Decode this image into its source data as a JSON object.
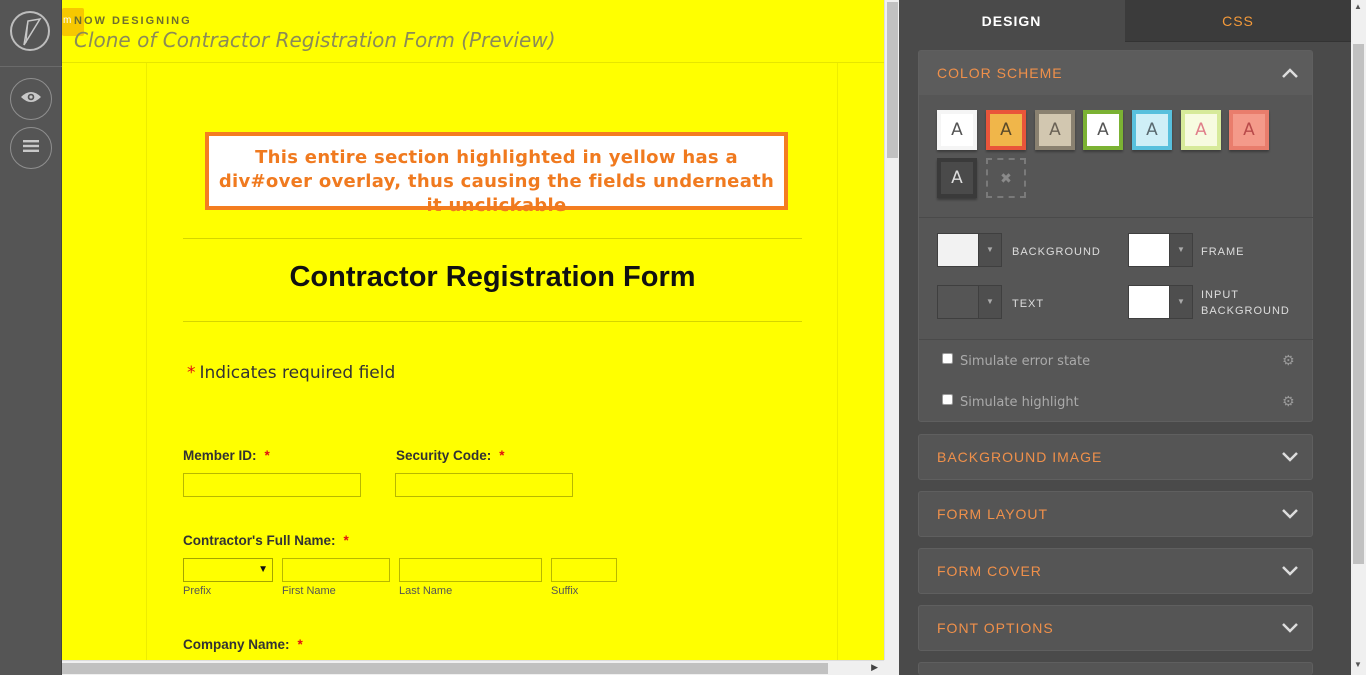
{
  "header": {
    "badge": "m",
    "label": "NOW DESIGNING",
    "title": "Clone of Contractor Registration Form (Preview)"
  },
  "rail": {
    "logo_icon": "pencil-logo-icon",
    "buttons": [
      "eye-icon",
      "menu-icon"
    ]
  },
  "form": {
    "note": "This entire section highlighted in yellow has a div#over overlay, thus causing the fields underneath it unclickable",
    "title": "Contractor Registration Form",
    "required_star": "*",
    "required_note": "Indicates required field",
    "fields": {
      "member_id": "Member ID:",
      "security_code": "Security Code:",
      "full_name": "Contractor's Full Name:",
      "company_name": "Company Name:"
    },
    "name_sublabels": [
      "Prefix",
      "First Name",
      "Last Name",
      "Suffix"
    ],
    "colors": {
      "overlay": "#ffff00",
      "note_border": "#f47d20",
      "required": "#e01010"
    }
  },
  "panel": {
    "tabs": [
      "DESIGN",
      "CSS"
    ],
    "color_scheme": {
      "title": "COLOR SCHEME",
      "swatch_letter": "A",
      "empty_swatch_icon": "close-icon",
      "pickers": {
        "background": "BACKGROUND",
        "frame": "FRAME",
        "text": "TEXT",
        "input_background_1": "INPUT",
        "input_background_2": "BACKGROUND"
      },
      "simulate_error": "Simulate error state",
      "simulate_highlight": "Simulate highlight"
    },
    "sections": [
      "BACKGROUND IMAGE",
      "FORM LAYOUT",
      "FORM COVER",
      "FONT OPTIONS"
    ],
    "accent": "#f0904a"
  }
}
